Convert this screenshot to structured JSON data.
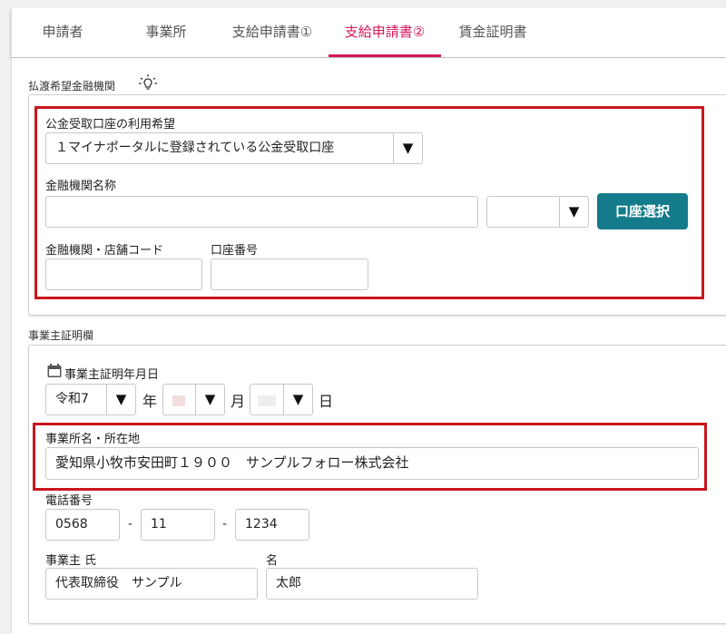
{
  "tabs": [
    {
      "label": "申請者",
      "active": false
    },
    {
      "label": "事業所",
      "active": false
    },
    {
      "label": "支給申請書①",
      "active": false
    },
    {
      "label": "支給申請書②",
      "active": true
    },
    {
      "label": "賃金証明書",
      "active": false
    }
  ],
  "bank": {
    "section_title": "払渡希望金融機関",
    "public_account_label": "公金受取口座の利用希望",
    "public_account_value": "１マイナポータルに登録されている公金受取口座",
    "institution_name_label": "金融機関名称",
    "institution_name_value": "",
    "institution_type_value": "",
    "account_select_button": "口座選択",
    "branch_code_label": "金融機関・店舗コード",
    "branch_code_value": "",
    "account_number_label": "口座番号",
    "account_number_value": ""
  },
  "employer": {
    "section_title": "事業主証明欄",
    "date_label": "事業主証明年月日",
    "era_value": "令和7",
    "year_unit": "年",
    "month_unit": "月",
    "day_unit": "日",
    "office_label": "事業所名・所在地",
    "office_value": "愛知県小牧市安田町１９００　サンプルフォロー株式会社",
    "phone_label": "電話番号",
    "phone_1": "0568",
    "phone_2": "11",
    "phone_3": "1234",
    "phone_sep": "-",
    "owner_last_label": "事業主 氏",
    "owner_last_value": "代表取締役　サンプル",
    "owner_first_label": "名",
    "owner_first_value": "太郎"
  },
  "colors": {
    "accent": "#d6195c",
    "button": "#147b8a",
    "highlight": "#c8161d"
  }
}
